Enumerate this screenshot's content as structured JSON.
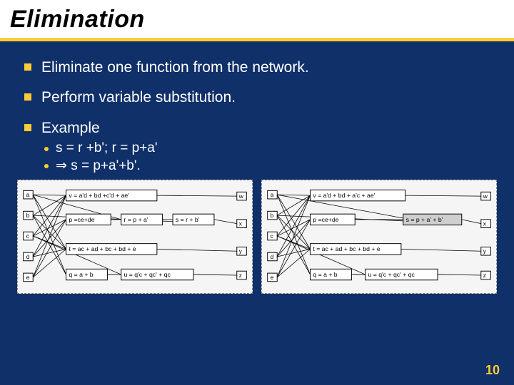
{
  "title": "Elimination",
  "bullets": [
    "Eliminate one function from the network.",
    "Perform variable substitution.",
    "Example"
  ],
  "subbullets": [
    "s = r +b'; r = p+a'",
    "⇒ s = p+a'+b'."
  ],
  "pagenum": "10",
  "left": {
    "inputs": [
      "a",
      "b",
      "c",
      "d",
      "e"
    ],
    "outputs": [
      "w",
      "x",
      "y",
      "z"
    ],
    "eq_v": "v = a'd + bd +c'd + ae'",
    "eq_p": "p =ce+de",
    "eq_r": "r = p + a'",
    "eq_s": "s = r + b'",
    "eq_t": "t = ac + ad + bc + bd + e",
    "eq_q": "q = a + b",
    "eq_u": "u = q'c + qc' + qc"
  },
  "right": {
    "inputs": [
      "a",
      "b",
      "c",
      "d",
      "e"
    ],
    "outputs": [
      "w",
      "x",
      "y",
      "z"
    ],
    "eq_v": "v = a'd + bd + a'c + ae'",
    "eq_p": "p =ce+de",
    "eq_s_hl": "s = p + a' + b'",
    "eq_t": "t = ac + ad + bc + bd + e",
    "eq_q": "q = a + b",
    "eq_u": "u = q'c + qc' + qc"
  }
}
